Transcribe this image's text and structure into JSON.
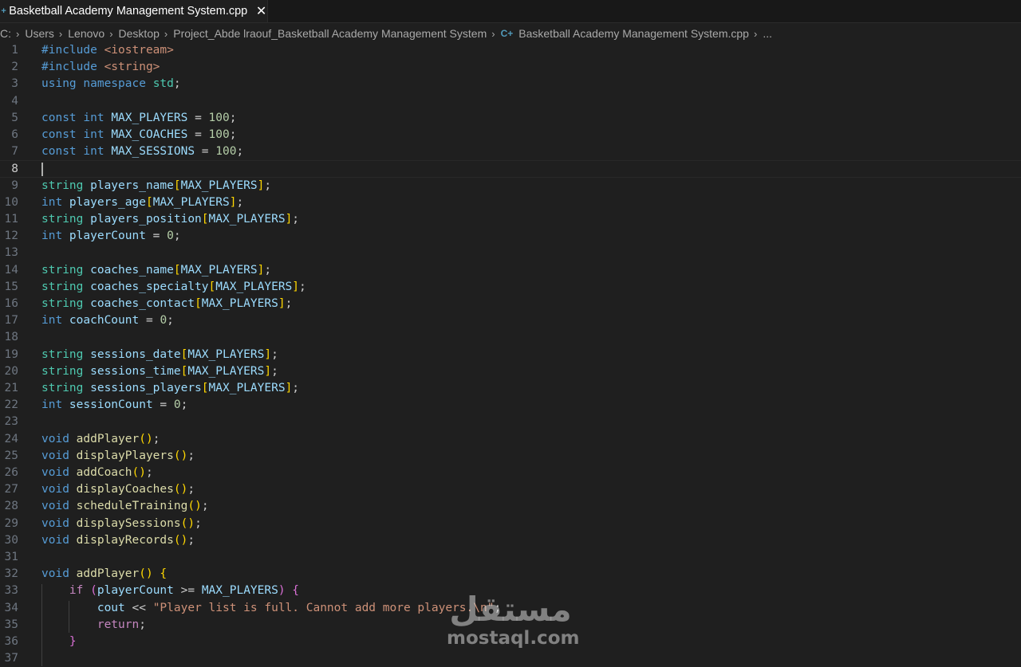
{
  "tab": {
    "title": "Basketball Academy Management System.cpp",
    "close_glyph": "✕"
  },
  "breadcrumb": [
    {
      "label": "C:"
    },
    {
      "label": "Users"
    },
    {
      "label": "Lenovo"
    },
    {
      "label": "Desktop"
    },
    {
      "label": "Project_Abde lraouf_Basketball Academy Management System"
    },
    {
      "label": "Basketball Academy Management System.cpp",
      "icon": "cpp-file-icon"
    },
    {
      "label": "..."
    }
  ],
  "editor": {
    "cursor_line": 8,
    "lines": [
      [
        [
          "#include ",
          "#569cd6"
        ],
        [
          "<iostream>",
          "#ce9178"
        ]
      ],
      [
        [
          "#include ",
          "#569cd6"
        ],
        [
          "<string>",
          "#ce9178"
        ]
      ],
      [
        [
          "using ",
          "#569cd6"
        ],
        [
          "namespace ",
          "#569cd6"
        ],
        [
          "std",
          "#4ec9b0"
        ],
        [
          ";",
          "#cccccc"
        ]
      ],
      [],
      [
        [
          "const ",
          "#569cd6"
        ],
        [
          "int ",
          "#569cd6"
        ],
        [
          "MAX_PLAYERS",
          "#9cdcfe"
        ],
        [
          " = ",
          "#cccccc"
        ],
        [
          "100",
          "#b5cea8"
        ],
        [
          ";",
          "#cccccc"
        ]
      ],
      [
        [
          "const ",
          "#569cd6"
        ],
        [
          "int ",
          "#569cd6"
        ],
        [
          "MAX_COACHES",
          "#9cdcfe"
        ],
        [
          " = ",
          "#cccccc"
        ],
        [
          "100",
          "#b5cea8"
        ],
        [
          ";",
          "#cccccc"
        ]
      ],
      [
        [
          "const ",
          "#569cd6"
        ],
        [
          "int ",
          "#569cd6"
        ],
        [
          "MAX_SESSIONS",
          "#9cdcfe"
        ],
        [
          " = ",
          "#cccccc"
        ],
        [
          "100",
          "#b5cea8"
        ],
        [
          ";",
          "#cccccc"
        ]
      ],
      [],
      [
        [
          "string ",
          "#4ec9b0"
        ],
        [
          "players_name",
          "#9cdcfe"
        ],
        [
          "[",
          "#ffd700"
        ],
        [
          "MAX_PLAYERS",
          "#9cdcfe"
        ],
        [
          "]",
          "#ffd700"
        ],
        [
          ";",
          "#cccccc"
        ]
      ],
      [
        [
          "int ",
          "#569cd6"
        ],
        [
          "players_age",
          "#9cdcfe"
        ],
        [
          "[",
          "#ffd700"
        ],
        [
          "MAX_PLAYERS",
          "#9cdcfe"
        ],
        [
          "]",
          "#ffd700"
        ],
        [
          ";",
          "#cccccc"
        ]
      ],
      [
        [
          "string ",
          "#4ec9b0"
        ],
        [
          "players_position",
          "#9cdcfe"
        ],
        [
          "[",
          "#ffd700"
        ],
        [
          "MAX_PLAYERS",
          "#9cdcfe"
        ],
        [
          "]",
          "#ffd700"
        ],
        [
          ";",
          "#cccccc"
        ]
      ],
      [
        [
          "int ",
          "#569cd6"
        ],
        [
          "playerCount",
          "#9cdcfe"
        ],
        [
          " = ",
          "#cccccc"
        ],
        [
          "0",
          "#b5cea8"
        ],
        [
          ";",
          "#cccccc"
        ]
      ],
      [],
      [
        [
          "string ",
          "#4ec9b0"
        ],
        [
          "coaches_name",
          "#9cdcfe"
        ],
        [
          "[",
          "#ffd700"
        ],
        [
          "MAX_PLAYERS",
          "#9cdcfe"
        ],
        [
          "]",
          "#ffd700"
        ],
        [
          ";",
          "#cccccc"
        ]
      ],
      [
        [
          "string ",
          "#4ec9b0"
        ],
        [
          "coaches_specialty",
          "#9cdcfe"
        ],
        [
          "[",
          "#ffd700"
        ],
        [
          "MAX_PLAYERS",
          "#9cdcfe"
        ],
        [
          "]",
          "#ffd700"
        ],
        [
          ";",
          "#cccccc"
        ]
      ],
      [
        [
          "string ",
          "#4ec9b0"
        ],
        [
          "coaches_contact",
          "#9cdcfe"
        ],
        [
          "[",
          "#ffd700"
        ],
        [
          "MAX_PLAYERS",
          "#9cdcfe"
        ],
        [
          "]",
          "#ffd700"
        ],
        [
          ";",
          "#cccccc"
        ]
      ],
      [
        [
          "int ",
          "#569cd6"
        ],
        [
          "coachCount",
          "#9cdcfe"
        ],
        [
          " = ",
          "#cccccc"
        ],
        [
          "0",
          "#b5cea8"
        ],
        [
          ";",
          "#cccccc"
        ]
      ],
      [],
      [
        [
          "string ",
          "#4ec9b0"
        ],
        [
          "sessions_date",
          "#9cdcfe"
        ],
        [
          "[",
          "#ffd700"
        ],
        [
          "MAX_PLAYERS",
          "#9cdcfe"
        ],
        [
          "]",
          "#ffd700"
        ],
        [
          ";",
          "#cccccc"
        ]
      ],
      [
        [
          "string ",
          "#4ec9b0"
        ],
        [
          "sessions_time",
          "#9cdcfe"
        ],
        [
          "[",
          "#ffd700"
        ],
        [
          "MAX_PLAYERS",
          "#9cdcfe"
        ],
        [
          "]",
          "#ffd700"
        ],
        [
          ";",
          "#cccccc"
        ]
      ],
      [
        [
          "string ",
          "#4ec9b0"
        ],
        [
          "sessions_players",
          "#9cdcfe"
        ],
        [
          "[",
          "#ffd700"
        ],
        [
          "MAX_PLAYERS",
          "#9cdcfe"
        ],
        [
          "]",
          "#ffd700"
        ],
        [
          ";",
          "#cccccc"
        ]
      ],
      [
        [
          "int ",
          "#569cd6"
        ],
        [
          "sessionCount",
          "#9cdcfe"
        ],
        [
          " = ",
          "#cccccc"
        ],
        [
          "0",
          "#b5cea8"
        ],
        [
          ";",
          "#cccccc"
        ]
      ],
      [],
      [
        [
          "void ",
          "#569cd6"
        ],
        [
          "addPlayer",
          "#dcdcaa"
        ],
        [
          "()",
          "#ffd700"
        ],
        [
          ";",
          "#cccccc"
        ]
      ],
      [
        [
          "void ",
          "#569cd6"
        ],
        [
          "displayPlayers",
          "#dcdcaa"
        ],
        [
          "()",
          "#ffd700"
        ],
        [
          ";",
          "#cccccc"
        ]
      ],
      [
        [
          "void ",
          "#569cd6"
        ],
        [
          "addCoach",
          "#dcdcaa"
        ],
        [
          "()",
          "#ffd700"
        ],
        [
          ";",
          "#cccccc"
        ]
      ],
      [
        [
          "void ",
          "#569cd6"
        ],
        [
          "displayCoaches",
          "#dcdcaa"
        ],
        [
          "()",
          "#ffd700"
        ],
        [
          ";",
          "#cccccc"
        ]
      ],
      [
        [
          "void ",
          "#569cd6"
        ],
        [
          "scheduleTraining",
          "#dcdcaa"
        ],
        [
          "()",
          "#ffd700"
        ],
        [
          ";",
          "#cccccc"
        ]
      ],
      [
        [
          "void ",
          "#569cd6"
        ],
        [
          "displaySessions",
          "#dcdcaa"
        ],
        [
          "()",
          "#ffd700"
        ],
        [
          ";",
          "#cccccc"
        ]
      ],
      [
        [
          "void ",
          "#569cd6"
        ],
        [
          "displayRecords",
          "#dcdcaa"
        ],
        [
          "()",
          "#ffd700"
        ],
        [
          ";",
          "#cccccc"
        ]
      ],
      [],
      [
        [
          "void ",
          "#569cd6"
        ],
        [
          "addPlayer",
          "#dcdcaa"
        ],
        [
          "() {",
          "#ffd700"
        ]
      ],
      [
        [
          "    ",
          "#cccccc"
        ],
        [
          "if ",
          "#c586c0"
        ],
        [
          "(",
          "#da70d6"
        ],
        [
          "playerCount",
          "#9cdcfe"
        ],
        [
          " >= ",
          "#cccccc"
        ],
        [
          "MAX_PLAYERS",
          "#9cdcfe"
        ],
        [
          ") {",
          "#da70d6"
        ]
      ],
      [
        [
          "        ",
          "#cccccc"
        ],
        [
          "cout",
          "#9cdcfe"
        ],
        [
          " << ",
          "#cccccc"
        ],
        [
          "\"Player list is full. Cannot add more players.\\n\"",
          "#ce9178"
        ],
        [
          ";",
          "#cccccc"
        ]
      ],
      [
        [
          "        ",
          "#cccccc"
        ],
        [
          "return",
          "#c586c0"
        ],
        [
          ";",
          "#cccccc"
        ]
      ],
      [
        [
          "    ",
          "#cccccc"
        ],
        [
          "}",
          "#da70d6"
        ]
      ],
      []
    ]
  },
  "watermark": {
    "arabic": "مستقل",
    "latin": "mostaql.com"
  }
}
